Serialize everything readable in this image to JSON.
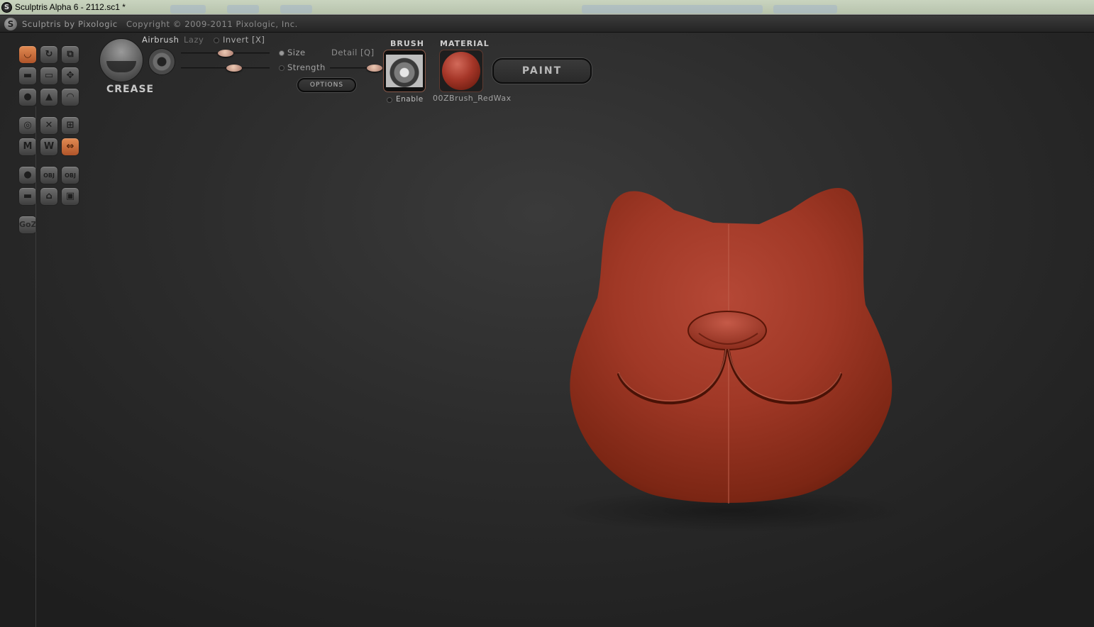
{
  "window": {
    "title": "Sculptris Alpha 6 - 2112.sc1 *"
  },
  "header": {
    "brand": "Sculptris by Pixologic",
    "copyright": "Copyright © 2009-2011 Pixologic, Inc."
  },
  "toolbar": {
    "brush_name": "CREASE",
    "airbrush_label": "Airbrush",
    "lazy_label": "Lazy",
    "invert_label": "Invert [X]",
    "size_label": "Size",
    "detail_label": "Detail [Q]",
    "strength_label": "Strength",
    "options_label": "OPTIONS",
    "brush_section_label": "BRUSH",
    "enable_label": "Enable",
    "material_section_label": "MATERIAL",
    "material_name": "00ZBrush_RedWax",
    "paint_label": "PAINT",
    "size_value": 0.5,
    "strength_value": 0.6,
    "detail_value": 0.9
  },
  "left_tools": [
    {
      "name": "crease-tool",
      "icon": "crease-icon",
      "active": true
    },
    {
      "name": "rotate-tool",
      "icon": "rotate-icon",
      "active": false
    },
    {
      "name": "scale-tool",
      "icon": "scale-icon",
      "active": false
    },
    {
      "name": "draw-tool",
      "icon": "draw-icon",
      "active": false
    },
    {
      "name": "flatten-tool",
      "icon": "flatten-icon",
      "active": false
    },
    {
      "name": "grab-tool",
      "icon": "move-icon",
      "active": false
    },
    {
      "name": "inflate-tool",
      "icon": "inflate-icon",
      "active": false
    },
    {
      "name": "pinch-tool",
      "icon": "pinch-icon",
      "active": false
    },
    {
      "name": "smooth-tool",
      "icon": "smooth-icon",
      "active": false
    },
    {
      "name": "reduce-brush-tool",
      "icon": "reduce-brush-icon",
      "active": false
    },
    {
      "name": "reduce-selected-tool",
      "icon": "reduce-selected-icon",
      "active": false
    },
    {
      "name": "wireframe-tool",
      "icon": "wireframe-icon",
      "active": false
    },
    {
      "name": "mask-tool",
      "icon": "mask-icon",
      "active": false
    },
    {
      "name": "subdivide-tool",
      "icon": "subdivide-icon",
      "active": false
    },
    {
      "name": "symmetry-tool",
      "icon": "symmetry-icon",
      "active": true
    },
    {
      "name": "new-sphere-tool",
      "icon": "sphere-icon",
      "active": false
    },
    {
      "name": "import-obj-tool",
      "icon": "obj-icon",
      "label": "OBJ",
      "active": false
    },
    {
      "name": "export-obj-tool",
      "icon": "obj-icon",
      "label": "OBJ",
      "active": false
    },
    {
      "name": "new-plane-tool",
      "icon": "plane-icon",
      "active": false
    },
    {
      "name": "open-file-tool",
      "icon": "open-icon",
      "active": false
    },
    {
      "name": "save-file-tool",
      "icon": "save-icon",
      "active": false
    },
    {
      "name": "goz-tool",
      "icon": "goz-icon",
      "label": "GoZ",
      "active": false
    }
  ],
  "colors": {
    "accent": "#d4713c",
    "model": "#a63a28",
    "background": "#2c2c2c"
  }
}
